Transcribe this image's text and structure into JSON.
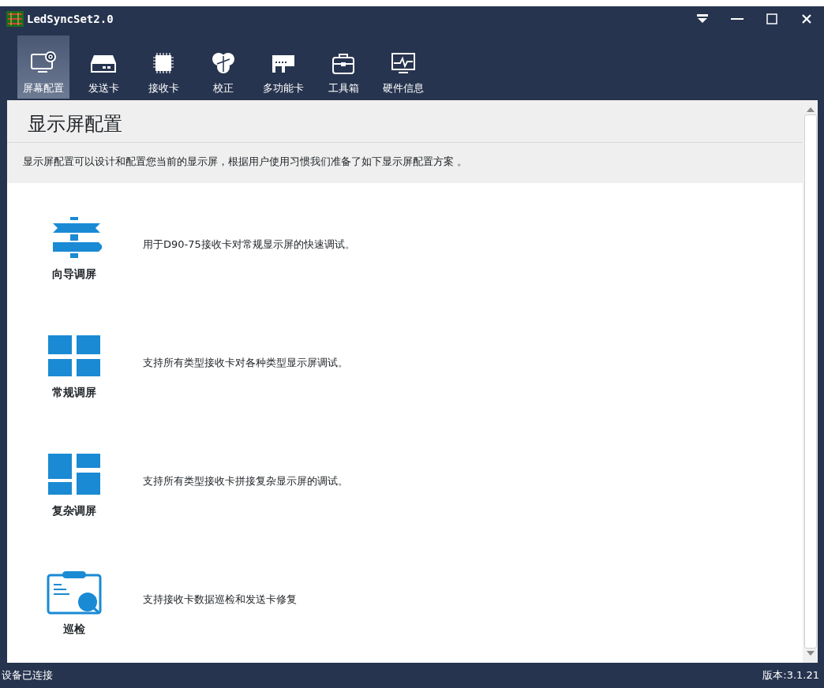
{
  "window": {
    "title": "LedSyncSet2.0"
  },
  "toolbar": [
    {
      "label": "屏幕配置",
      "kind": "monitor",
      "selected": true
    },
    {
      "label": "发送卡",
      "kind": "sender",
      "selected": false
    },
    {
      "label": "接收卡",
      "kind": "chip",
      "selected": false
    },
    {
      "label": "校正",
      "kind": "color",
      "selected": false
    },
    {
      "label": "多功能卡",
      "kind": "board",
      "selected": false
    },
    {
      "label": "工具箱",
      "kind": "toolbox",
      "selected": false
    },
    {
      "label": "硬件信息",
      "kind": "pulse",
      "selected": false
    }
  ],
  "page": {
    "title": "显示屏配置",
    "description": "显示屏配置可以设计和配置您当前的显示屏，根据用户使用习惯我们准备了如下显示屏配置方案 。"
  },
  "options": [
    {
      "label": "向导调屏",
      "kind": "signpost",
      "description": "用于D90-75接收卡对常规显示屏的快速调试。"
    },
    {
      "label": "常规调屏",
      "kind": "grid",
      "description": "支持所有类型接收卡对各种类型显示屏调试。"
    },
    {
      "label": "复杂调屏",
      "kind": "mosaic",
      "description": "支持所有类型接收卡拼接复杂显示屏的调试。"
    },
    {
      "label": "巡检",
      "kind": "inspect",
      "description": "支持接收卡数据巡检和发送卡修复"
    }
  ],
  "status_bar": {
    "left": "设备已连接",
    "right": "版本:3.1.21"
  }
}
